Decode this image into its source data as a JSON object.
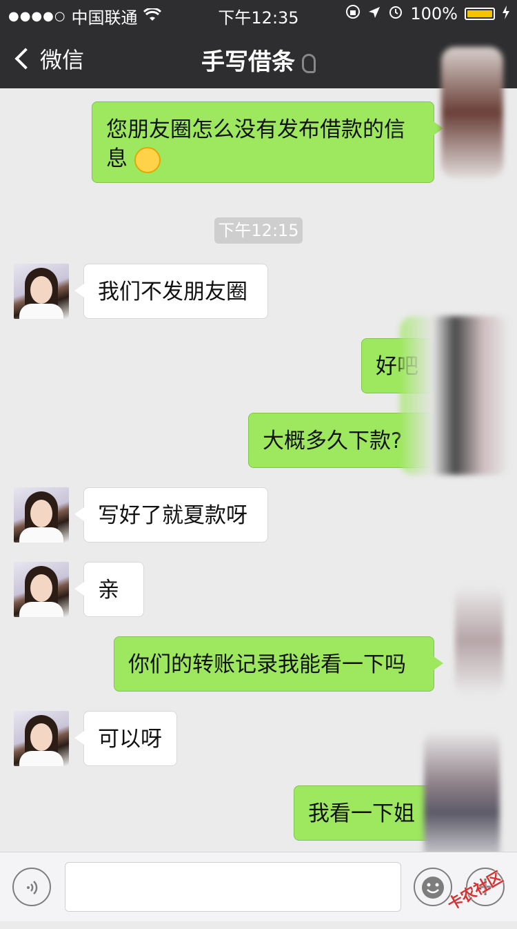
{
  "status_bar": {
    "signal_dots": "●●●●○",
    "carrier": "中国联通",
    "time": "下午12:35",
    "battery": "100%",
    "icons": [
      "wifi-icon",
      "lock-rotation-icon",
      "location-icon",
      "alarm-icon",
      "battery-icon",
      "charging-icon"
    ]
  },
  "nav": {
    "back_label": "微信",
    "title": "手写借条"
  },
  "chat": {
    "timestamp": "下午12:15",
    "messages": [
      {
        "side": "right",
        "text": "您朋友圈怎么没有发布借款的信息"
      },
      {
        "side": "left",
        "text": "我们不发朋友圈"
      },
      {
        "side": "right",
        "text": "好吧"
      },
      {
        "side": "right",
        "text": "大概多久下款?"
      },
      {
        "side": "left",
        "text": "写好了就夏款呀"
      },
      {
        "side": "left",
        "text": "亲"
      },
      {
        "side": "right",
        "text": "你们的转账记录我能看一下吗"
      },
      {
        "side": "left",
        "text": "可以呀"
      },
      {
        "side": "right",
        "text": "我看一下姐"
      }
    ]
  },
  "input_bar": {
    "placeholder": "",
    "icons": [
      "voice-icon",
      "emoji-icon",
      "plus-icon"
    ]
  },
  "watermark": "卡农社区",
  "colors": {
    "nav_bg": "#2e2e30",
    "bubble_green": "#9de85e",
    "chat_bg": "#ebebeb"
  }
}
